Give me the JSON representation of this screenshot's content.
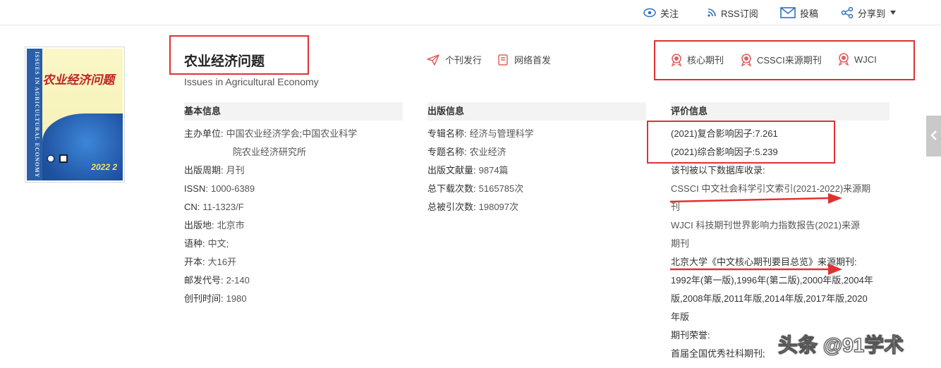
{
  "topbar": {
    "follow": "关注",
    "rss": "RSS订阅",
    "submit": "投稿",
    "share": "分享到"
  },
  "journal": {
    "title": "农业经济问题",
    "subtitle": "Issues in Agricultural Economy",
    "cover": {
      "band_text": "ISSUES IN AGRICULTURAL ECONOMY",
      "title": "农业经济问题",
      "issue": "2022 2"
    }
  },
  "pub_tags": [
    "个刊发行",
    "网络首发"
  ],
  "badges": [
    "核心期刊",
    "CSSCI来源期刊",
    "WJCI"
  ],
  "basic": {
    "heading": "基本信息",
    "rows": [
      {
        "key": "主办单位:",
        "value": "中国农业经济学会;中国农业科学"
      },
      {
        "key": "",
        "value": "院农业经济研究所"
      },
      {
        "key": "出版周期:",
        "value": "月刊"
      },
      {
        "key": "ISSN:",
        "value": "1000-6389"
      },
      {
        "key": "CN:",
        "value": "11-1323/F"
      },
      {
        "key": "出版地:",
        "value": "北京市"
      },
      {
        "key": "语种:",
        "value": "中文;"
      },
      {
        "key": "开本:",
        "value": "大16开"
      },
      {
        "key": "邮发代号:",
        "value": "2-140"
      },
      {
        "key": "创刊时间:",
        "value": "1980"
      }
    ]
  },
  "publication": {
    "heading": "出版信息",
    "rows": [
      {
        "key": "专辑名称:",
        "value": "经济与管理科学"
      },
      {
        "key": "专题名称:",
        "value": "农业经济"
      },
      {
        "key": "出版文献量:",
        "value": "9874篇"
      },
      {
        "key": "总下载次数:",
        "value": "5165785次"
      },
      {
        "key": "总被引次数:",
        "value": "198097次"
      }
    ]
  },
  "evaluation": {
    "heading": "评价信息",
    "lines": [
      "(2021)复合影响因子:7.261",
      "(2021)综合影响因子:5.239",
      "该刊被以下数据库收录:",
      "CSSCI 中文社会科学引文索引(2021-2022)来源期",
      "刊",
      "WJCI 科技期刊世界影响力指数报告(2021)来源",
      "期刊",
      "北京大学《中文核心期刊要目总览》来源期刊:",
      "1992年(第一版),1996年(第二版),2000年版,2004年",
      "版,2008年版,2011年版,2014年版,2017年版,2020",
      "年版",
      "期刊荣誉:",
      "首届全国优秀社科期刊;"
    ]
  },
  "watermark": "头条 @91学术",
  "colors": {
    "annotation_red": "#e03131",
    "icon_blue": "#2f6fc8",
    "badge_red": "#e06060"
  }
}
